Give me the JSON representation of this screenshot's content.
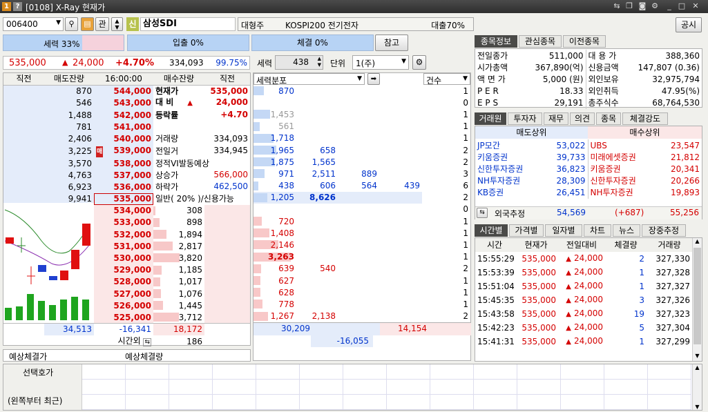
{
  "window": {
    "title": "[0108] X-Ray 현재가",
    "badge1": "1",
    "badge2": "?"
  },
  "topbar": {
    "code": "006400",
    "ban": "관",
    "shin": "신",
    "stock_name": "삼성SDI",
    "sector_size": "대형주",
    "sector_index": "KOSPI200 전기전자",
    "loan_ratio": "대출70%",
    "notice_btn": "공시"
  },
  "ratiobar": {
    "force": "세력 33%",
    "inout": "입출 0%",
    "fill": "체결 0%",
    "ref_btn": "참고"
  },
  "price": {
    "current": "535,000",
    "arrow": "▲",
    "change": "24,000",
    "pct": "+4.70%",
    "volume": "334,093",
    "rate": "99.75%",
    "force_label": "세력",
    "force_value": "438",
    "unit_label": "단위",
    "unit_value": "1(주)"
  },
  "orderbook": {
    "headers": {
      "prev": "직전",
      "sell_rem": "매도잔량",
      "time": "16:00:00",
      "buy_rem": "매수잔량",
      "prev2": "직전"
    },
    "asks": [
      {
        "rem": "870",
        "price": "544,000"
      },
      {
        "rem": "546",
        "price": "543,000"
      },
      {
        "rem": "1,488",
        "price": "542,000"
      },
      {
        "rem": "781",
        "price": "541,000"
      },
      {
        "rem": "2,406",
        "price": "540,000"
      },
      {
        "rem": "3,225",
        "price": "539,000",
        "mark": "매"
      },
      {
        "rem": "3,570",
        "price": "538,000"
      },
      {
        "rem": "4,763",
        "price": "537,000"
      },
      {
        "rem": "6,923",
        "price": "536,000"
      },
      {
        "rem": "9,941",
        "price": "535,000"
      }
    ],
    "bids": [
      {
        "price": "534,000",
        "rem": "308"
      },
      {
        "price": "533,000",
        "rem": "898"
      },
      {
        "price": "532,000",
        "rem": "1,894"
      },
      {
        "price": "531,000",
        "rem": "2,817"
      },
      {
        "price": "530,000",
        "rem": "3,820"
      },
      {
        "price": "529,000",
        "rem": "1,185"
      },
      {
        "price": "528,000",
        "rem": "1,017"
      },
      {
        "price": "527,000",
        "rem": "1,076"
      },
      {
        "price": "526,000",
        "rem": "1,445"
      },
      {
        "price": "525,000",
        "rem": "3,712"
      }
    ],
    "info": [
      {
        "label": "현재가",
        "value": "535,000"
      },
      {
        "label": "대 비",
        "arrow": "▲",
        "value": "24,000"
      },
      {
        "label": "등락률",
        "value": "+4.70"
      },
      {
        "label": "",
        "value": ""
      },
      {
        "label": "거래량",
        "value": "334,093"
      },
      {
        "label": "전일거",
        "value": "334,945"
      },
      {
        "label": "정적VI발동예상",
        "value": ""
      },
      {
        "label": "상승가",
        "value": "566,000"
      },
      {
        "label": "하락가",
        "value": "462,500"
      },
      {
        "label": "일반( 20% )/신용가능",
        "value": ""
      }
    ],
    "totals": {
      "sell": "34,513",
      "net": "-16,341",
      "buy": "18,172",
      "after_label": "시간외",
      "after_value": "186"
    },
    "expected": {
      "price_label": "예상체결가",
      "vol_label": "예상체결량"
    }
  },
  "force_dist": {
    "header": "세력분포",
    "count_header": "건수",
    "rows": [
      {
        "v": [
          "870",
          "",
          "",
          ""
        ],
        "n": "1"
      },
      {
        "v": [
          "",
          "",
          "",
          ""
        ],
        "n": "0"
      },
      {
        "v": [
          "1,453",
          "",
          "",
          ""
        ],
        "n": "1",
        "gray": true
      },
      {
        "v": [
          "561",
          "",
          "",
          ""
        ],
        "n": "1",
        "gray": true
      },
      {
        "v": [
          "1,718",
          "",
          "",
          ""
        ],
        "n": "1"
      },
      {
        "v": [
          "1,965",
          "658",
          "",
          ""
        ],
        "n": "2"
      },
      {
        "v": [
          "1,875",
          "1,565",
          "",
          ""
        ],
        "n": "2"
      },
      {
        "v": [
          "971",
          "2,511",
          "889",
          ""
        ],
        "n": "3"
      },
      {
        "v": [
          "438",
          "606",
          "564",
          "439"
        ],
        "n": "6"
      },
      {
        "v": [
          "1,205",
          "8,626",
          "",
          ""
        ],
        "n": "2"
      },
      {
        "v": [
          "",
          "",
          "",
          ""
        ],
        "n": "0"
      },
      {
        "v": [
          "720",
          "",
          "",
          ""
        ],
        "n": "1"
      },
      {
        "v": [
          "1,408",
          "",
          "",
          ""
        ],
        "n": "1"
      },
      {
        "v": [
          "2,146",
          "",
          "",
          ""
        ],
        "n": "1"
      },
      {
        "v": [
          "3,263",
          "",
          "",
          ""
        ],
        "n": "1"
      },
      {
        "v": [
          "639",
          "540",
          "",
          ""
        ],
        "n": "2"
      },
      {
        "v": [
          "627",
          "",
          "",
          ""
        ],
        "n": "1"
      },
      {
        "v": [
          "628",
          "",
          "",
          ""
        ],
        "n": "1"
      },
      {
        "v": [
          "778",
          "",
          "",
          ""
        ],
        "n": "1"
      },
      {
        "v": [
          "1,267",
          "2,138",
          "",
          ""
        ],
        "n": "2"
      }
    ],
    "totals": {
      "sell": "30,209",
      "buy": "14,154",
      "net": "-16,055"
    }
  },
  "info_panel": {
    "tabs": [
      "종목정보",
      "관심종목",
      "이전종목"
    ],
    "left": [
      [
        "전일종가",
        "511,000"
      ],
      [
        "시가총액",
        "367,890(억)"
      ],
      [
        "액 면 가",
        "5,000 (원)"
      ],
      [
        "P E R",
        "18.33"
      ],
      [
        "E P S",
        "29,191"
      ]
    ],
    "right": [
      [
        "대 용 가",
        "388,360"
      ],
      [
        "신용금액",
        "147,807  (0.36)"
      ],
      [
        "외인보유",
        "32,975,794"
      ],
      [
        "외인취득",
        "47.95(%)"
      ],
      [
        "총주식수",
        "68,764,530"
      ]
    ]
  },
  "broker_panel": {
    "tabs": [
      "거래원",
      "투자자",
      "재무",
      "의견",
      "종목",
      "체결강도"
    ],
    "sell_header": "매도상위",
    "buy_header": "매수상위",
    "rows": [
      [
        "JP모간",
        "53,022",
        "UBS",
        "23,547"
      ],
      [
        "키움증권",
        "39,733",
        "미래에셋증권",
        "21,812"
      ],
      [
        "신한투자증권",
        "36,823",
        "키움증권",
        "20,341"
      ],
      [
        "NH투자증권",
        "28,309",
        "신한투자증권",
        "20,266"
      ],
      [
        "KB증권",
        "26,451",
        "NH투자증권",
        "19,893"
      ]
    ],
    "foreign": {
      "label": "외국추정",
      "sell": "54,569",
      "diff": "(+687)",
      "buy": "55,256"
    }
  },
  "time_panel": {
    "tabs": [
      "시간별",
      "가격별",
      "일자별",
      "차트",
      "뉴스",
      "장중추정"
    ],
    "headers": [
      "시간",
      "현재가",
      "전일대비",
      "체결량",
      "거래량"
    ],
    "rows": [
      [
        "15:55:29",
        "535,000",
        "24,000",
        "2",
        "327,330"
      ],
      [
        "15:53:39",
        "535,000",
        "24,000",
        "1",
        "327,328"
      ],
      [
        "15:51:04",
        "535,000",
        "24,000",
        "1",
        "327,327"
      ],
      [
        "15:45:35",
        "535,000",
        "24,000",
        "3",
        "327,326"
      ],
      [
        "15:43:58",
        "535,000",
        "24,000",
        "19",
        "327,323"
      ],
      [
        "15:42:23",
        "535,000",
        "24,000",
        "5",
        "327,304"
      ],
      [
        "15:41:31",
        "535,000",
        "24,000",
        "1",
        "327,299"
      ]
    ]
  },
  "select_quote": {
    "label1": "선택호가",
    "label2": "(왼쪽부터 최근)"
  },
  "colors": {
    "sell": "#0033cc",
    "buy": "#d40000",
    "sell_bg": "#e4ecfa",
    "buy_bg": "#fbe7e7"
  }
}
